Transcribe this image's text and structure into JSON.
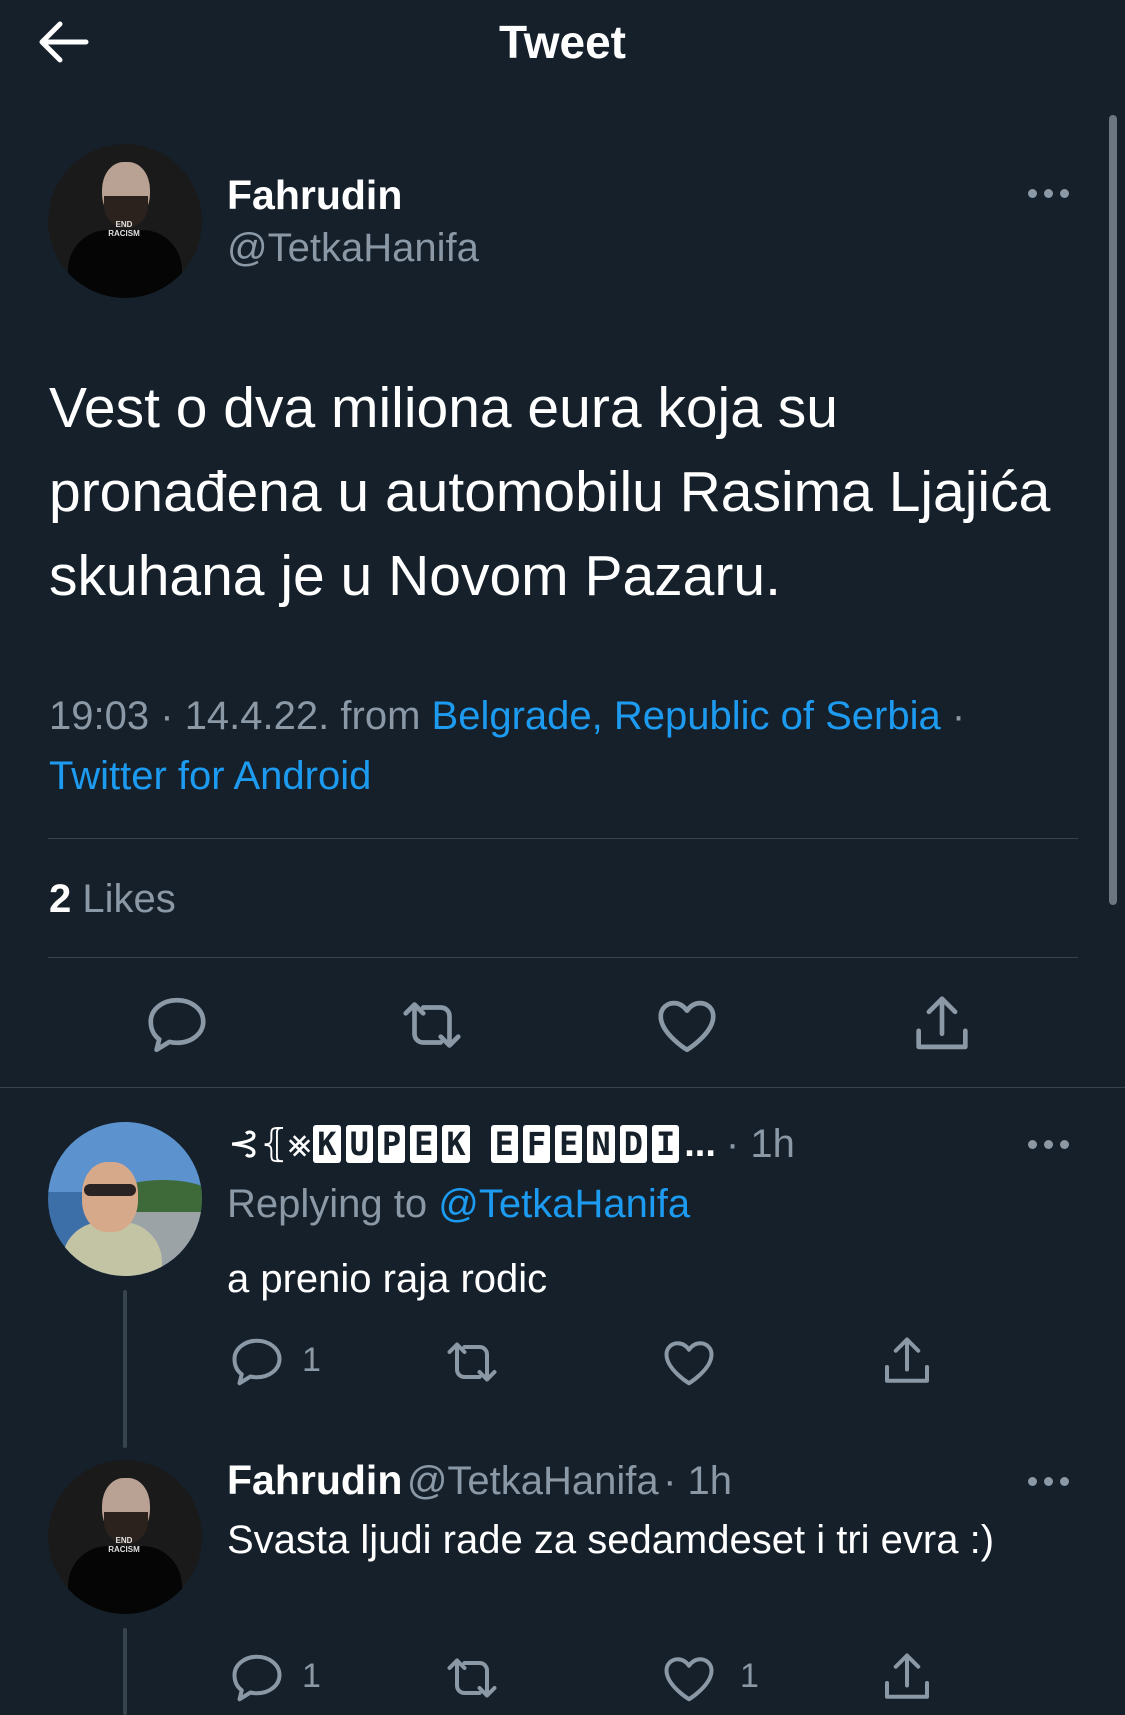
{
  "header": {
    "title": "Tweet"
  },
  "main_tweet": {
    "author_name": "Fahrudin",
    "author_handle": "@TetkaHanifa",
    "avatar_shirt_text": "END RACISM",
    "text": "Vest o dva miliona eura koja su pronađena u automobilu Rasima Ljajića skuhana je u Novom Pazaru.",
    "time": "19:03",
    "date": "14.4.22.",
    "from_label": "from",
    "location": "Belgrade, Republic of Serbia",
    "client": "Twitter for Android",
    "separator": "·",
    "likes_count": "2",
    "likes_label": "Likes"
  },
  "replies": [
    {
      "author_symbols": "⊰⦃⨳",
      "author_boxes": [
        "K",
        "U",
        "P",
        "E",
        "K"
      ],
      "author_boxes2": [
        "E",
        "F",
        "E",
        "N",
        "D",
        "I"
      ],
      "author_ellipsis": "...",
      "time": "· 1h",
      "replying_label": "Replying to",
      "replying_handle": "@TetkaHanifa",
      "text": "a prenio raja rodic",
      "reply_count": "1",
      "retweet_count": "",
      "like_count": ""
    },
    {
      "author_name": "Fahrudin",
      "author_handle": "@TetkaHanifa",
      "time": "· 1h",
      "avatar_shirt_text": "END RACISM",
      "text": "Svasta ljudi rade za sedamdeset i tri evra :)",
      "reply_count": "1",
      "retweet_count": "",
      "like_count": "1"
    }
  ],
  "colors": {
    "background": "#15202b",
    "text": "#ffffff",
    "muted": "#8b98a5",
    "accent": "#1d9bf0",
    "divider": "#38444d"
  },
  "icons": [
    "back-arrow-icon",
    "more-icon",
    "reply-icon",
    "retweet-icon",
    "like-icon",
    "share-icon"
  ]
}
